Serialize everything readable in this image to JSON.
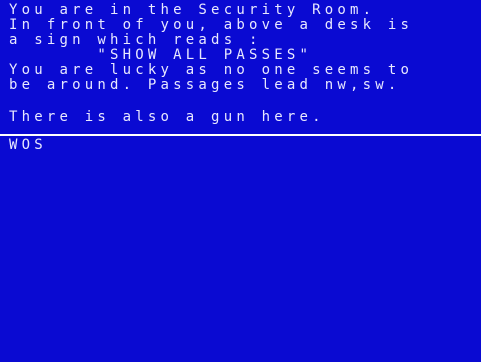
{
  "location": {
    "lines": [
      "You are in the Security Room.",
      "In front of you, above a desk is",
      "a sign which reads :",
      "       \"SHOW ALL PASSES\"",
      "You are lucky as no one seems to",
      "be around. Passages lead nw,sw."
    ]
  },
  "objects": {
    "line": "There is also a gun here."
  },
  "input": {
    "text": "WOS"
  },
  "colors": {
    "background": "#0a0ad2",
    "text": "#e8e8ff",
    "divider": "#ffffff"
  }
}
